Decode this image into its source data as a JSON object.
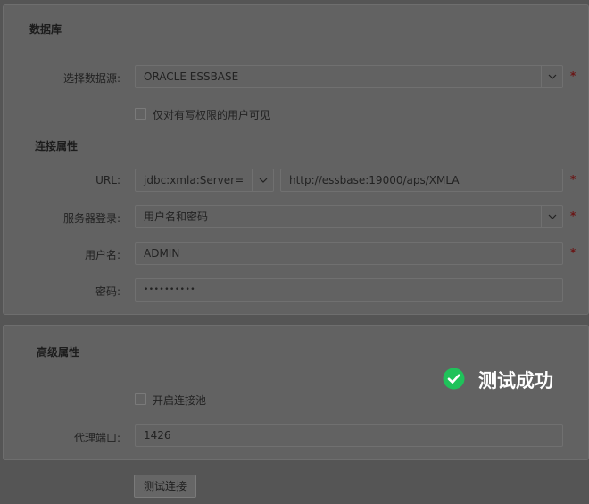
{
  "database": {
    "title": "数据库",
    "datasource_label": "选择数据源:",
    "datasource_value": "ORACLE ESSBASE",
    "write_only_checkbox_label": "仅对有写权限的用户可见",
    "connection_section_title": "连接属性",
    "url_label": "URL:",
    "url_prefix_value": "jdbc:xmla:Server=",
    "url_value": "http://essbase:19000/aps/XMLA",
    "server_login_label": "服务器登录:",
    "server_login_value": "用户名和密码",
    "username_label": "用户名:",
    "username_value": "ADMIN",
    "password_label": "密码:",
    "password_value": "••••••••••",
    "required_mark": "*"
  },
  "advanced": {
    "title": "高级属性",
    "pool_checkbox_label": "开启连接池",
    "proxy_port_label": "代理端口:",
    "proxy_port_value": "1426"
  },
  "actions": {
    "test_button_label": "测试连接"
  },
  "toast": {
    "message": "测试成功",
    "icon": "check-circle-icon",
    "icon_color": "#1fc25a"
  }
}
